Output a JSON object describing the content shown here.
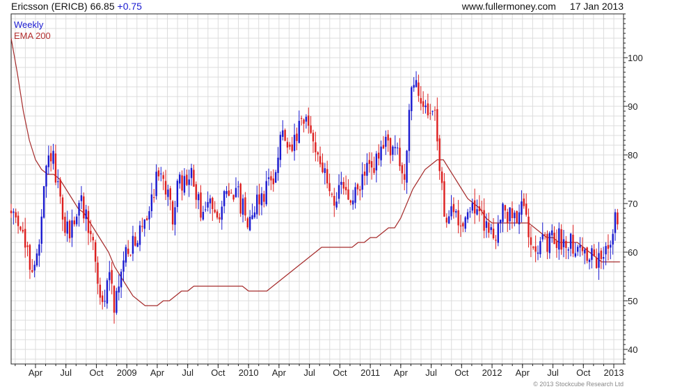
{
  "header": {
    "ticker": "Ericsson (ERICB)",
    "price": "66.85",
    "change": "+0.75",
    "site": "www.fullermoney.com",
    "date": "17 Jan 2013"
  },
  "legend": {
    "series1": "Weekly",
    "series2": "EMA 200"
  },
  "copyright": "© 2013 Stockcube Research Ltd",
  "colors": {
    "up": "#1a1ad0",
    "down": "#dd1f1f",
    "ema": "#a52a2a",
    "grid": "#dcdcdc",
    "axis": "#222222"
  },
  "chart_data": {
    "type": "candlestick",
    "ylim": [
      37,
      109
    ],
    "yticks": [
      40,
      50,
      60,
      70,
      80,
      90,
      100
    ],
    "xlim": [
      2008.05,
      2013.08
    ],
    "xticks": [
      {
        "label": "Apr",
        "t": 2008.25
      },
      {
        "label": "Jul",
        "t": 2008.5
      },
      {
        "label": "Oct",
        "t": 2008.75
      },
      {
        "label": "2009",
        "t": 2009.0
      },
      {
        "label": "Apr",
        "t": 2009.25
      },
      {
        "label": "Jul",
        "t": 2009.5
      },
      {
        "label": "Oct",
        "t": 2009.75
      },
      {
        "label": "2010",
        "t": 2010.0
      },
      {
        "label": "Apr",
        "t": 2010.25
      },
      {
        "label": "Jul",
        "t": 2010.5
      },
      {
        "label": "Oct",
        "t": 2010.75
      },
      {
        "label": "2011",
        "t": 2011.0
      },
      {
        "label": "Apr",
        "t": 2011.25
      },
      {
        "label": "Jul",
        "t": 2011.5
      },
      {
        "label": "Oct",
        "t": 2011.75
      },
      {
        "label": "2012",
        "t": 2012.0
      },
      {
        "label": "Apr",
        "t": 2012.25
      },
      {
        "label": "Jul",
        "t": 2012.5
      },
      {
        "label": "Oct",
        "t": 2012.75
      },
      {
        "label": "2013",
        "t": 2013.0
      }
    ],
    "price_path": [
      [
        2008.05,
        68
      ],
      [
        2008.12,
        67
      ],
      [
        2008.18,
        59
      ],
      [
        2008.22,
        57
      ],
      [
        2008.28,
        60
      ],
      [
        2008.33,
        75
      ],
      [
        2008.38,
        81
      ],
      [
        2008.43,
        73
      ],
      [
        2008.48,
        65
      ],
      [
        2008.53,
        64
      ],
      [
        2008.58,
        68
      ],
      [
        2008.63,
        70
      ],
      [
        2008.68,
        66
      ],
      [
        2008.72,
        62
      ],
      [
        2008.76,
        55
      ],
      [
        2008.79,
        47
      ],
      [
        2008.83,
        52
      ],
      [
        2008.87,
        57
      ],
      [
        2008.9,
        49
      ],
      [
        2008.93,
        52
      ],
      [
        2008.97,
        58
      ],
      [
        2009.02,
        62
      ],
      [
        2009.08,
        60
      ],
      [
        2009.12,
        66
      ],
      [
        2009.18,
        69
      ],
      [
        2009.23,
        74
      ],
      [
        2009.28,
        78
      ],
      [
        2009.33,
        71
      ],
      [
        2009.38,
        68
      ],
      [
        2009.43,
        74
      ],
      [
        2009.48,
        74
      ],
      [
        2009.53,
        76
      ],
      [
        2009.58,
        70
      ],
      [
        2009.63,
        68
      ],
      [
        2009.7,
        70
      ],
      [
        2009.78,
        69
      ],
      [
        2009.85,
        74
      ],
      [
        2009.9,
        72
      ],
      [
        2009.95,
        69
      ],
      [
        2010.0,
        67
      ],
      [
        2010.05,
        70
      ],
      [
        2010.12,
        72
      ],
      [
        2010.18,
        75
      ],
      [
        2010.23,
        78
      ],
      [
        2010.28,
        85
      ],
      [
        2010.33,
        79
      ],
      [
        2010.37,
        82
      ],
      [
        2010.42,
        85
      ],
      [
        2010.47,
        87
      ],
      [
        2010.52,
        84
      ],
      [
        2010.58,
        80
      ],
      [
        2010.63,
        75
      ],
      [
        2010.68,
        72
      ],
      [
        2010.73,
        71
      ],
      [
        2010.78,
        73
      ],
      [
        2010.85,
        70
      ],
      [
        2010.92,
        74
      ],
      [
        2010.97,
        77
      ],
      [
        2011.02,
        78
      ],
      [
        2011.08,
        79
      ],
      [
        2011.13,
        83
      ],
      [
        2011.18,
        82
      ],
      [
        2011.23,
        79
      ],
      [
        2011.28,
        75
      ],
      [
        2011.32,
        90
      ],
      [
        2011.37,
        94
      ],
      [
        2011.41,
        92
      ],
      [
        2011.45,
        89
      ],
      [
        2011.5,
        91
      ],
      [
        2011.53,
        87
      ],
      [
        2011.57,
        78
      ],
      [
        2011.6,
        70
      ],
      [
        2011.64,
        67
      ],
      [
        2011.7,
        68
      ],
      [
        2011.75,
        66
      ],
      [
        2011.82,
        70
      ],
      [
        2011.88,
        68
      ],
      [
        2011.95,
        66
      ],
      [
        2012.0,
        63
      ],
      [
        2012.05,
        66
      ],
      [
        2012.1,
        68
      ],
      [
        2012.16,
        67
      ],
      [
        2012.22,
        69
      ],
      [
        2012.28,
        67
      ],
      [
        2012.33,
        63
      ],
      [
        2012.38,
        62
      ],
      [
        2012.45,
        61
      ],
      [
        2012.52,
        63
      ],
      [
        2012.58,
        62
      ],
      [
        2012.63,
        63
      ],
      [
        2012.7,
        61
      ],
      [
        2012.75,
        60
      ],
      [
        2012.8,
        59
      ],
      [
        2012.85,
        58
      ],
      [
        2012.9,
        58
      ],
      [
        2012.95,
        62
      ],
      [
        2013.0,
        66
      ],
      [
        2013.04,
        67
      ]
    ],
    "ema_path": [
      [
        2008.05,
        104
      ],
      [
        2008.1,
        97
      ],
      [
        2008.15,
        89
      ],
      [
        2008.2,
        83
      ],
      [
        2008.25,
        79
      ],
      [
        2008.3,
        77
      ],
      [
        2008.35,
        76
      ],
      [
        2008.4,
        76
      ],
      [
        2008.45,
        75
      ],
      [
        2008.5,
        73
      ],
      [
        2008.55,
        71
      ],
      [
        2008.6,
        69
      ],
      [
        2008.65,
        68
      ],
      [
        2008.7,
        66
      ],
      [
        2008.75,
        64
      ],
      [
        2008.8,
        62
      ],
      [
        2008.85,
        60
      ],
      [
        2008.9,
        57
      ],
      [
        2008.95,
        55
      ],
      [
        2009.0,
        53
      ],
      [
        2009.05,
        51
      ],
      [
        2009.1,
        50
      ],
      [
        2009.15,
        49
      ],
      [
        2009.2,
        49
      ],
      [
        2009.25,
        49
      ],
      [
        2009.3,
        50
      ],
      [
        2009.35,
        50
      ],
      [
        2009.4,
        51
      ],
      [
        2009.45,
        52
      ],
      [
        2009.5,
        52
      ],
      [
        2009.55,
        53
      ],
      [
        2009.6,
        53
      ],
      [
        2009.65,
        53
      ],
      [
        2009.7,
        53
      ],
      [
        2009.75,
        53
      ],
      [
        2009.8,
        53
      ],
      [
        2009.85,
        53
      ],
      [
        2009.9,
        53
      ],
      [
        2009.95,
        53
      ],
      [
        2010.0,
        52
      ],
      [
        2010.05,
        52
      ],
      [
        2010.1,
        52
      ],
      [
        2010.15,
        52
      ],
      [
        2010.2,
        53
      ],
      [
        2010.25,
        54
      ],
      [
        2010.3,
        55
      ],
      [
        2010.35,
        56
      ],
      [
        2010.4,
        57
      ],
      [
        2010.45,
        58
      ],
      [
        2010.5,
        59
      ],
      [
        2010.55,
        60
      ],
      [
        2010.6,
        61
      ],
      [
        2010.65,
        61
      ],
      [
        2010.7,
        61
      ],
      [
        2010.75,
        61
      ],
      [
        2010.8,
        61
      ],
      [
        2010.85,
        61
      ],
      [
        2010.9,
        62
      ],
      [
        2010.95,
        62
      ],
      [
        2011.0,
        63
      ],
      [
        2011.05,
        63
      ],
      [
        2011.1,
        64
      ],
      [
        2011.15,
        65
      ],
      [
        2011.2,
        65
      ],
      [
        2011.25,
        67
      ],
      [
        2011.3,
        70
      ],
      [
        2011.35,
        73
      ],
      [
        2011.4,
        75
      ],
      [
        2011.45,
        77
      ],
      [
        2011.5,
        78
      ],
      [
        2011.55,
        79
      ],
      [
        2011.6,
        79
      ],
      [
        2011.65,
        77
      ],
      [
        2011.7,
        75
      ],
      [
        2011.75,
        73
      ],
      [
        2011.8,
        71
      ],
      [
        2011.85,
        70
      ],
      [
        2011.9,
        69
      ],
      [
        2011.95,
        67
      ],
      [
        2012.0,
        66
      ],
      [
        2012.05,
        66
      ],
      [
        2012.1,
        66
      ],
      [
        2012.15,
        66
      ],
      [
        2012.2,
        66
      ],
      [
        2012.25,
        66
      ],
      [
        2012.3,
        66
      ],
      [
        2012.35,
        65
      ],
      [
        2012.4,
        64
      ],
      [
        2012.45,
        63
      ],
      [
        2012.5,
        63
      ],
      [
        2012.55,
        62
      ],
      [
        2012.6,
        62
      ],
      [
        2012.65,
        62
      ],
      [
        2012.7,
        62
      ],
      [
        2012.75,
        61
      ],
      [
        2012.8,
        60
      ],
      [
        2012.85,
        59
      ],
      [
        2012.9,
        58
      ],
      [
        2012.95,
        58
      ],
      [
        2013.0,
        58
      ],
      [
        2013.05,
        58
      ]
    ]
  }
}
